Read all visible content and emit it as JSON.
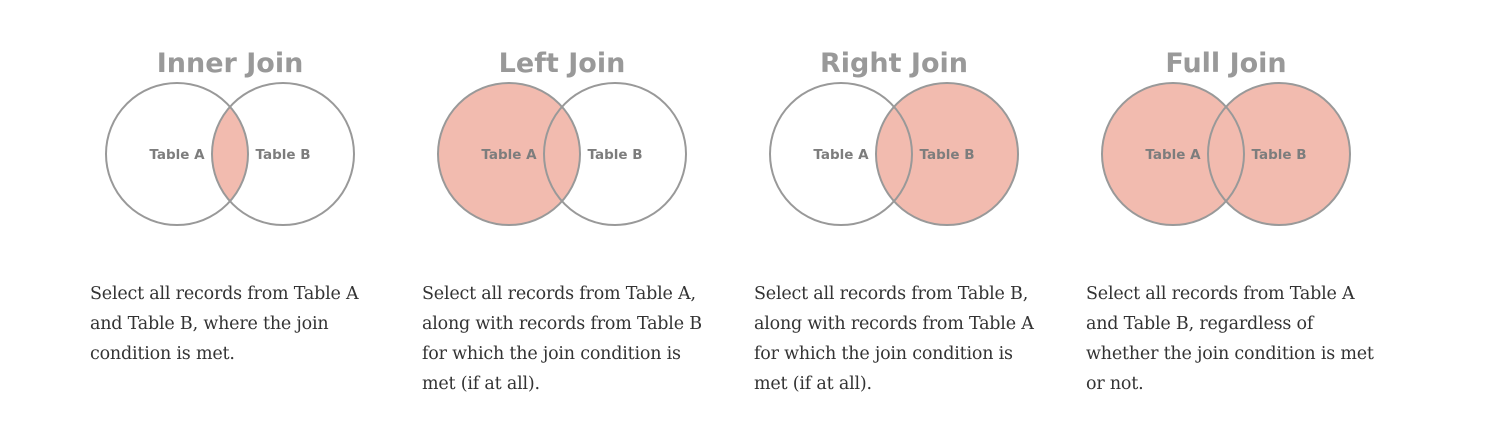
{
  "colors": {
    "fill": "#f2bbaf",
    "stroke": "#999999",
    "title": "#999999",
    "label": "#7d7d7d",
    "body_text": "#333333"
  },
  "joins": [
    {
      "title": "Inner Join",
      "table_a": "Table A",
      "table_b": "Table B",
      "highlight": "intersection",
      "description": "Select all records from Table A and Table B, where the join condition is met."
    },
    {
      "title": "Left Join",
      "table_a": "Table A",
      "table_b": "Table B",
      "highlight": "left",
      "description": "Select all records from Table A, along with records from Table B for which the join condition is met (if at all)."
    },
    {
      "title": "Right Join",
      "table_a": "Table A",
      "table_b": "Table B",
      "highlight": "right",
      "description": "Select all records from Table B, along with records from Table A for which the join condition is met (if at all)."
    },
    {
      "title": "Full Join",
      "table_a": "Table A",
      "table_b": "Table B",
      "highlight": "full",
      "description": "Select all records from Table A and Table B, regardless of whether the join condition is met or not."
    }
  ]
}
